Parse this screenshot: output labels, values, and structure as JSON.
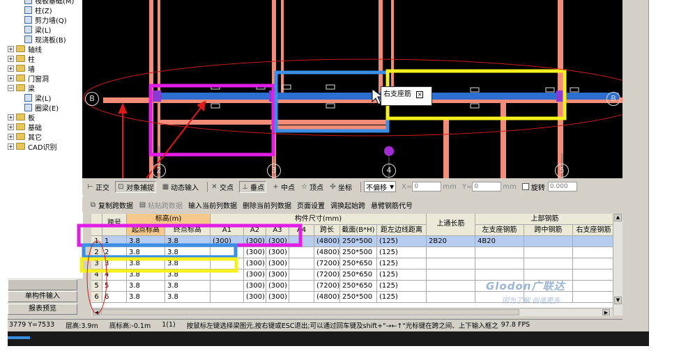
{
  "tree": {
    "items": [
      {
        "label": "筏板基础(M)",
        "type": "item",
        "depth": 2
      },
      {
        "label": "柱(Z)",
        "type": "item",
        "depth": 2
      },
      {
        "label": "剪力墙(Q)",
        "type": "item",
        "depth": 2
      },
      {
        "label": "梁(L)",
        "type": "item",
        "depth": 2
      },
      {
        "label": "现浇板(B)",
        "type": "item",
        "depth": 2
      },
      {
        "label": "轴线",
        "type": "folder",
        "depth": 1
      },
      {
        "label": "柱",
        "type": "folder",
        "depth": 1
      },
      {
        "label": "墙",
        "type": "folder",
        "depth": 1
      },
      {
        "label": "门窗洞",
        "type": "folder",
        "depth": 1
      },
      {
        "label": "梁",
        "type": "folder-open",
        "depth": 1
      },
      {
        "label": "梁(L)",
        "type": "item",
        "depth": 2
      },
      {
        "label": "圈梁(E)",
        "type": "item",
        "depth": 2
      },
      {
        "label": "板",
        "type": "folder",
        "depth": 1
      },
      {
        "label": "基础",
        "type": "folder",
        "depth": 1
      },
      {
        "label": "其它",
        "type": "folder",
        "depth": 1
      },
      {
        "label": "CAD识别",
        "type": "folder",
        "depth": 1
      }
    ],
    "buttons": [
      "单构件输入",
      "报表预览"
    ]
  },
  "canvas": {
    "axis_labels": [
      "B",
      "2",
      "3",
      "4",
      "5",
      "B"
    ],
    "tooltip": "右支座筋",
    "colors": {
      "background": "#000000",
      "column": "#f08c78",
      "beam": "#2d6fd0",
      "highlight_pink": "#e21ee6",
      "highlight_blue": "#3a8ee6",
      "highlight_yellow": "#f5f01e",
      "ellipse": "#cc1a1a",
      "arrow": "#e01818"
    }
  },
  "toolbar1": {
    "items": [
      "正交",
      "对象捕捉",
      "动态输入",
      "交点",
      "垂点",
      "中点",
      "顶点",
      "坐标"
    ],
    "offset_select": "不偏移",
    "x_label": "X=",
    "x_value": "0",
    "x_unit": "mm",
    "y_label": "Y=",
    "y_value": "0",
    "y_unit": "mm",
    "rotate_label": "旋转",
    "rotate_value": "0.000"
  },
  "toolbar2": {
    "items": [
      "复制跨数据",
      "粘贴跨数据",
      "输入当前列数据",
      "删除当前列数据",
      "页面设置",
      "调换起始跨",
      "悬臂钢筋代号"
    ]
  },
  "table": {
    "group_headers": {
      "elevation": "标高(m)",
      "dimensions": "构件尺寸(mm)",
      "top_rebar": "上部钢筋"
    },
    "columns": [
      "跨号",
      "起点标高",
      "终点标高",
      "A1",
      "A2",
      "A3",
      "A4",
      "跨长",
      "截面(B*H)",
      "距左边线距离",
      "上通长筋",
      "左支座钢筋",
      "跨中钢筋",
      "右支座钢筋"
    ],
    "rows": [
      {
        "n": "1",
        "span": "1",
        "start": "3.8",
        "end": "3.8",
        "a1": "(300)",
        "a2": "(300)",
        "a3": "(300)",
        "a4": "",
        "len": "(4800)",
        "sec": "250*500",
        "dist": "(125)",
        "top": "2B20",
        "left": "4B20",
        "mid": "",
        "right": ""
      },
      {
        "n": "2",
        "span": "2",
        "start": "3.8",
        "end": "3.8",
        "a1": "",
        "a2": "(300)",
        "a3": "(300)",
        "a4": "",
        "len": "(4800)",
        "sec": "250*500",
        "dist": "(125)",
        "top": "",
        "left": "",
        "mid": "",
        "right": ""
      },
      {
        "n": "3",
        "span": "3",
        "start": "3.8",
        "end": "3.8",
        "a1": "",
        "a2": "(300)",
        "a3": "(300)",
        "a4": "",
        "len": "(7200)",
        "sec": "250*650",
        "dist": "(125)",
        "top": "",
        "left": "",
        "mid": "",
        "right": ""
      },
      {
        "n": "4",
        "span": "4",
        "start": "3.8",
        "end": "3.8",
        "a1": "",
        "a2": "(300)",
        "a3": "(300)",
        "a4": "",
        "len": "(7200)",
        "sec": "250*650",
        "dist": "(125)",
        "top": "",
        "left": "",
        "mid": "",
        "right": ""
      },
      {
        "n": "5",
        "span": "5",
        "start": "3.8",
        "end": "3.8",
        "a1": "",
        "a2": "(300)",
        "a3": "(300)",
        "a4": "",
        "len": "(7200)",
        "sec": "250*650",
        "dist": "(125)",
        "top": "",
        "left": "",
        "mid": "",
        "right": ""
      },
      {
        "n": "6",
        "span": "6",
        "start": "3.8",
        "end": "3.8",
        "a1": "",
        "a2": "(300)",
        "a3": "(300)",
        "a4": "",
        "len": "(4800)",
        "sec": "250*500",
        "dist": "(125)",
        "top": "",
        "left": "",
        "mid": "",
        "right": ""
      }
    ]
  },
  "watermark": {
    "logo": "Glodon广联达",
    "slogan": "因为了解 创造更多"
  },
  "status": {
    "coords": "3779 Y=7533",
    "floor_height": "层高:3.9m",
    "base_elev": "底标高:-0.1m",
    "count": "1(1)",
    "hint": "按鼠标左键选择梁图元,按右键或ESC退出;可以通过回车键及shift+\"→←↑\"光标键在跨之间、上下输入框之",
    "fps": "97.8 FPS"
  }
}
